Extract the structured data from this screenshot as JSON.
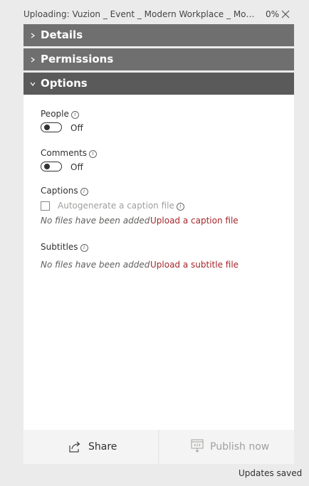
{
  "upload": {
    "file_label": "Uploading: Vuzion _ Event _ Modern Workplace _ Monthly T...",
    "percent": "0%",
    "close_icon": "close-icon"
  },
  "sections": {
    "details": "Details",
    "permissions": "Permissions",
    "options": "Options"
  },
  "options": {
    "people": {
      "label": "People",
      "state": "Off"
    },
    "comments": {
      "label": "Comments",
      "state": "Off"
    },
    "captions": {
      "label": "Captions",
      "autogenerate": "Autogenerate a caption file",
      "no_files": "No files have been added",
      "upload_link": "Upload a caption file"
    },
    "subtitles": {
      "label": "Subtitles",
      "no_files": "No files have been added",
      "upload_link": "Upload a subtitle file"
    },
    "info_glyph": "i"
  },
  "footer": {
    "share": "Share",
    "publish": "Publish now",
    "status": "Updates saved"
  },
  "colors": {
    "header_bg": "#6f6f6f",
    "active_header_bg": "#5a5a5a",
    "link": "#a4262c",
    "disabled_text": "#a19f9d"
  }
}
